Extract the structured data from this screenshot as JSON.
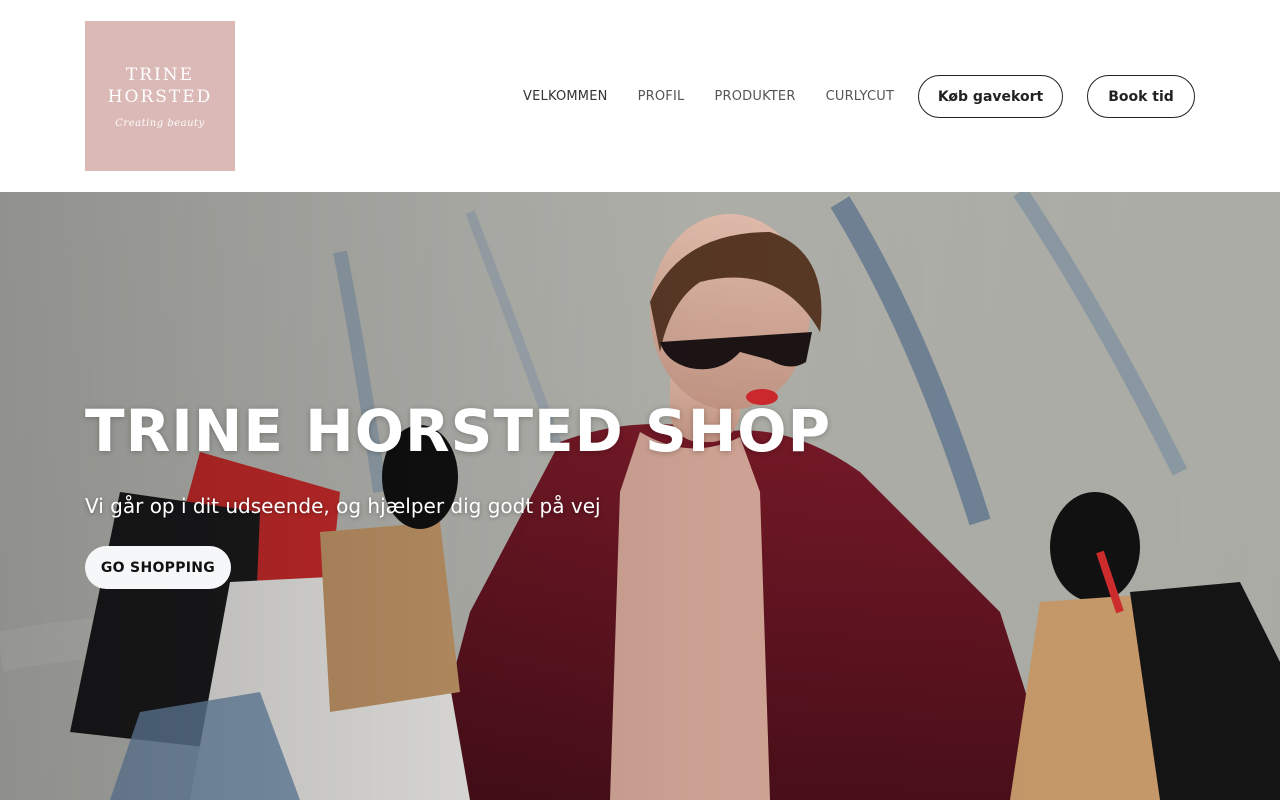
{
  "brand": {
    "logo_line1": "TRINE",
    "logo_line2": "HORSTED",
    "logo_tagline": "Creating beauty",
    "logo_color": "#dbb9b7"
  },
  "nav": {
    "items": [
      {
        "label": "VELKOMMEN"
      },
      {
        "label": "PROFIL"
      },
      {
        "label": "PRODUKTER"
      },
      {
        "label": "CURLYCUT"
      }
    ],
    "gift_card_label": "Køb gavekort",
    "book_label": "Book tid"
  },
  "hero": {
    "title": "TRINE HORSTED SHOP",
    "subtitle": "Vi går op i dit udseende, og hjælper dig godt på vej",
    "cta_label": "GO SHOPPING",
    "image": "photo-woman-with-shopping-bags"
  }
}
